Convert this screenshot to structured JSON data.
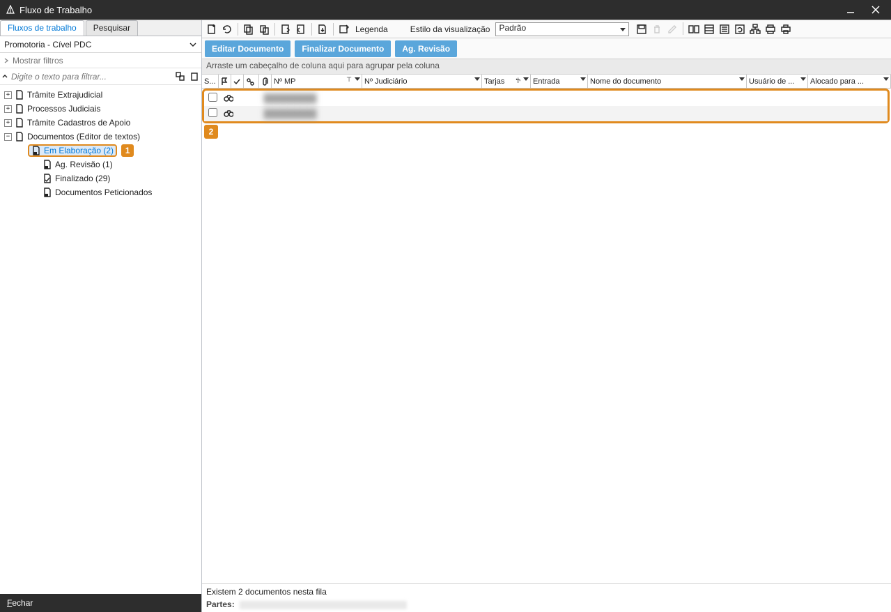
{
  "window": {
    "title": "Fluxo de Trabalho"
  },
  "sidebar": {
    "tabs": {
      "workflows": "Fluxos de trabalho",
      "search": "Pesquisar"
    },
    "combo": "Promotoria - Cível PDC",
    "show_filters": "Mostrar filtros",
    "filter_placeholder": "Digite o texto para filtrar...",
    "tree": {
      "n0": "Trâmite Extrajudicial",
      "n1": "Processos Judiciais",
      "n2": "Trâmite Cadastros de Apoio",
      "n3": "Documentos (Editor de textos)",
      "n3a": "Em Elaboração (2)",
      "n3b": "Ag. Revisão (1)",
      "n3c": "Finalizado (29)",
      "n3d": "Documentos Peticionados"
    }
  },
  "callouts": {
    "one": "1",
    "two": "2"
  },
  "toolbar": {
    "legend": "Legenda",
    "viz_label": "Estilo da visualização",
    "viz_value": "Padrão"
  },
  "buttons": {
    "edit": "Editar Documento",
    "finalize": "Finalizar Documento",
    "review": "Ag. Revisão"
  },
  "grid": {
    "group_hint": "Arraste um cabeçalho de coluna aqui para agrupar pela coluna",
    "cols": {
      "s": "S...",
      "mp": "Nº MP",
      "jud": "Nº Judiciário",
      "tarjas": "Tarjas",
      "entrada": "Entrada",
      "nomedoc": "Nome do documento",
      "usuario": "Usuário de ...",
      "alocado": "Alocado para ..."
    }
  },
  "status": {
    "count": "Existem 2 documentos nesta fila",
    "partes_label": "Partes:"
  },
  "footer": {
    "close_f": "F",
    "close_rest": "echar"
  }
}
